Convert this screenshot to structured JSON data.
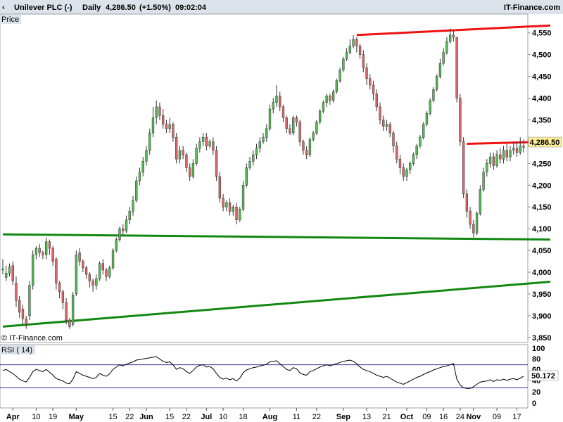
{
  "header": {
    "instrument": "Unilever PLC (-)",
    "period": "Daily",
    "last": "4,286.50",
    "change": "(+1.50%)",
    "time": "09:02:04",
    "brand": "IT-Finance.com"
  },
  "price_panel": {
    "label": "Price",
    "watermark": "© IT-Finance.com",
    "current_price_label": "4,286.50"
  },
  "rsi_panel": {
    "label": "RSI ( 14)",
    "current_value_label": "50.172",
    "ticks": [
      "100",
      "80",
      "60",
      "40",
      "20",
      "0"
    ]
  },
  "colors": {
    "up_candle": "#55bb55",
    "down_candle": "#dd6666",
    "resistance": "#ee1111",
    "support": "#118811",
    "rsi_line": "#000000",
    "rsi_band": "#333399",
    "header_bg": "#dde3ea",
    "price_tag_bg": "#ffee99"
  },
  "chart_data": {
    "type": "candlestick",
    "ylim": [
      3840,
      4590
    ],
    "y_ticks": [
      3850,
      3900,
      3950,
      4000,
      4050,
      4100,
      4150,
      4200,
      4250,
      4300,
      4350,
      4400,
      4450,
      4500,
      4550
    ],
    "y_tick_labels": [
      "3,850",
      "3,900",
      "3,950",
      "4,000",
      "4,050",
      "4,100",
      "4,150",
      "4,200",
      "4,250",
      "4,300",
      "4,350",
      "4,400",
      "4,450",
      "4,500",
      "4,550"
    ],
    "x_tick_labels": [
      "Apr",
      "10",
      "19",
      "May",
      "15",
      "22",
      "Jun",
      "15",
      "22",
      "Jul",
      "10",
      "18",
      "Aug",
      "11",
      "22",
      "Sep",
      "13",
      "21",
      "Oct",
      "09",
      "16",
      "24",
      "Nov",
      "09",
      "17"
    ],
    "x_tick_bold": [
      "Apr",
      "May",
      "Jun",
      "Jul",
      "Aug",
      "Sep",
      "Oct",
      "Nov"
    ],
    "x_tick_index": [
      3,
      10,
      15,
      22,
      33,
      38,
      43,
      50,
      55,
      61,
      66,
      72,
      80,
      88,
      94,
      102,
      109,
      115,
      121,
      127,
      132,
      137,
      141,
      148,
      154
    ],
    "candles": [
      [
        4005,
        4008,
        4030,
        3995
      ],
      [
        3988,
        3998,
        4015,
        3980
      ],
      [
        3998,
        4012,
        4020,
        3990
      ],
      [
        4015,
        3980,
        4025,
        3970
      ],
      [
        3975,
        3935,
        3990,
        3920
      ],
      [
        3935,
        3908,
        3945,
        3895
      ],
      [
        3915,
        3893,
        3925,
        3880
      ],
      [
        3892,
        3880,
        3900,
        3870
      ],
      [
        3900,
        3970,
        3980,
        3890
      ],
      [
        3970,
        4040,
        4050,
        3960
      ],
      [
        4040,
        4055,
        4060,
        4030
      ],
      [
        4055,
        4045,
        4065,
        4035
      ],
      [
        4045,
        4040,
        4050,
        4030
      ],
      [
        4040,
        4070,
        4080,
        4030
      ],
      [
        4070,
        4055,
        4075,
        4040
      ],
      [
        4055,
        4025,
        4060,
        4015
      ],
      [
        4030,
        3975,
        4035,
        3960
      ],
      [
        3975,
        3955,
        3980,
        3940
      ],
      [
        3955,
        3930,
        3960,
        3915
      ],
      [
        3930,
        3890,
        3940,
        3880
      ],
      [
        3890,
        3875,
        3895,
        3870
      ],
      [
        3880,
        3948,
        3955,
        3875
      ],
      [
        3950,
        4040,
        4050,
        3945
      ],
      [
        4045,
        4025,
        4055,
        4015
      ],
      [
        4025,
        4010,
        4030,
        4000
      ],
      [
        4010,
        3995,
        4015,
        3985
      ],
      [
        3995,
        3980,
        4000,
        3965
      ],
      [
        3980,
        3970,
        3985,
        3955
      ],
      [
        3970,
        3985,
        3995,
        3960
      ],
      [
        3985,
        4020,
        4025,
        3980
      ],
      [
        4020,
        4005,
        4030,
        3995
      ],
      [
        4005,
        3990,
        4010,
        3980
      ],
      [
        3990,
        4010,
        4015,
        3985
      ],
      [
        4010,
        4050,
        4055,
        4005
      ],
      [
        4050,
        4075,
        4080,
        4045
      ],
      [
        4075,
        4100,
        4105,
        4070
      ],
      [
        4100,
        4095,
        4110,
        4085
      ],
      [
        4095,
        4120,
        4130,
        4090
      ],
      [
        4120,
        4140,
        4150,
        4110
      ],
      [
        4140,
        4165,
        4175,
        4130
      ],
      [
        4165,
        4210,
        4220,
        4160
      ],
      [
        4210,
        4230,
        4240,
        4200
      ],
      [
        4230,
        4255,
        4265,
        4220
      ],
      [
        4255,
        4280,
        4290,
        4245
      ],
      [
        4280,
        4320,
        4330,
        4270
      ],
      [
        4320,
        4355,
        4380,
        4310
      ],
      [
        4355,
        4380,
        4395,
        4340
      ],
      [
        4380,
        4360,
        4390,
        4350
      ],
      [
        4360,
        4340,
        4375,
        4330
      ],
      [
        4340,
        4330,
        4350,
        4320
      ],
      [
        4330,
        4340,
        4355,
        4320
      ],
      [
        4340,
        4310,
        4345,
        4300
      ],
      [
        4310,
        4260,
        4320,
        4250
      ],
      [
        4260,
        4280,
        4290,
        4250
      ],
      [
        4280,
        4270,
        4290,
        4260
      ],
      [
        4270,
        4240,
        4275,
        4230
      ],
      [
        4240,
        4220,
        4250,
        4210
      ],
      [
        4220,
        4250,
        4260,
        4215
      ],
      [
        4250,
        4285,
        4295,
        4245
      ],
      [
        4285,
        4300,
        4310,
        4275
      ],
      [
        4300,
        4310,
        4320,
        4290
      ],
      [
        4310,
        4290,
        4320,
        4280
      ],
      [
        4290,
        4300,
        4305,
        4285
      ],
      [
        4300,
        4280,
        4310,
        4270
      ],
      [
        4280,
        4220,
        4290,
        4210
      ],
      [
        4220,
        4170,
        4230,
        4160
      ],
      [
        4170,
        4150,
        4180,
        4140
      ],
      [
        4150,
        4160,
        4165,
        4140
      ],
      [
        4160,
        4140,
        4170,
        4130
      ],
      [
        4140,
        4150,
        4155,
        4130
      ],
      [
        4150,
        4120,
        4160,
        4110
      ],
      [
        4120,
        4145,
        4150,
        4115
      ],
      [
        4145,
        4200,
        4210,
        4140
      ],
      [
        4200,
        4240,
        4250,
        4195
      ],
      [
        4240,
        4255,
        4265,
        4235
      ],
      [
        4255,
        4270,
        4280,
        4245
      ],
      [
        4270,
        4285,
        4295,
        4260
      ],
      [
        4285,
        4300,
        4310,
        4275
      ],
      [
        4300,
        4310,
        4320,
        4295
      ],
      [
        4310,
        4330,
        4340,
        4300
      ],
      [
        4330,
        4375,
        4385,
        4325
      ],
      [
        4375,
        4390,
        4400,
        4365
      ],
      [
        4390,
        4405,
        4430,
        4380
      ],
      [
        4405,
        4380,
        4415,
        4370
      ],
      [
        4380,
        4355,
        4385,
        4345
      ],
      [
        4355,
        4330,
        4360,
        4320
      ],
      [
        4330,
        4320,
        4340,
        4315
      ],
      [
        4320,
        4355,
        4360,
        4315
      ],
      [
        4355,
        4345,
        4360,
        4335
      ],
      [
        4345,
        4300,
        4350,
        4290
      ],
      [
        4300,
        4280,
        4305,
        4270
      ],
      [
        4280,
        4270,
        4290,
        4260
      ],
      [
        4270,
        4305,
        4310,
        4265
      ],
      [
        4305,
        4320,
        4325,
        4300
      ],
      [
        4320,
        4345,
        4350,
        4315
      ],
      [
        4345,
        4370,
        4375,
        4340
      ],
      [
        4370,
        4390,
        4395,
        4365
      ],
      [
        4390,
        4405,
        4410,
        4380
      ],
      [
        4405,
        4395,
        4410,
        4385
      ],
      [
        4395,
        4415,
        4420,
        4390
      ],
      [
        4415,
        4440,
        4445,
        4410
      ],
      [
        4440,
        4465,
        4470,
        4435
      ],
      [
        4465,
        4490,
        4495,
        4460
      ],
      [
        4490,
        4505,
        4515,
        4485
      ],
      [
        4505,
        4520,
        4535,
        4500
      ],
      [
        4520,
        4535,
        4545,
        4515
      ],
      [
        4535,
        4520,
        4540,
        4505
      ],
      [
        4520,
        4500,
        4525,
        4490
      ],
      [
        4500,
        4470,
        4510,
        4460
      ],
      [
        4470,
        4445,
        4480,
        4430
      ],
      [
        4445,
        4430,
        4455,
        4420
      ],
      [
        4430,
        4410,
        4440,
        4395
      ],
      [
        4410,
        4380,
        4420,
        4370
      ],
      [
        4380,
        4350,
        4390,
        4340
      ],
      [
        4350,
        4335,
        4360,
        4325
      ],
      [
        4335,
        4340,
        4350,
        4325
      ],
      [
        4340,
        4320,
        4345,
        4310
      ],
      [
        4320,
        4290,
        4325,
        4275
      ],
      [
        4290,
        4260,
        4300,
        4250
      ],
      [
        4260,
        4240,
        4270,
        4225
      ],
      [
        4240,
        4220,
        4250,
        4210
      ],
      [
        4220,
        4235,
        4240,
        4210
      ],
      [
        4235,
        4250,
        4255,
        4225
      ],
      [
        4250,
        4270,
        4275,
        4245
      ],
      [
        4270,
        4290,
        4295,
        4260
      ],
      [
        4290,
        4310,
        4315,
        4285
      ],
      [
        4310,
        4340,
        4345,
        4305
      ],
      [
        4340,
        4365,
        4370,
        4335
      ],
      [
        4365,
        4395,
        4400,
        4360
      ],
      [
        4395,
        4420,
        4425,
        4390
      ],
      [
        4420,
        4450,
        4455,
        4415
      ],
      [
        4450,
        4480,
        4490,
        4445
      ],
      [
        4480,
        4505,
        4515,
        4475
      ],
      [
        4505,
        4530,
        4540,
        4500
      ],
      [
        4530,
        4545,
        4560,
        4525
      ],
      [
        4545,
        4540,
        4555,
        4530
      ],
      [
        4540,
        4400,
        4450,
        4390
      ],
      [
        4400,
        4300,
        4410,
        4290
      ],
      [
        4300,
        4180,
        4310,
        4170
      ],
      [
        4180,
        4140,
        4190,
        4125
      ],
      [
        4140,
        4110,
        4150,
        4100
      ],
      [
        4110,
        4090,
        4120,
        4080
      ],
      [
        4090,
        4135,
        4140,
        4085
      ],
      [
        4135,
        4190,
        4200,
        4130
      ],
      [
        4190,
        4230,
        4240,
        4185
      ],
      [
        4230,
        4250,
        4260,
        4220
      ],
      [
        4250,
        4265,
        4275,
        4240
      ],
      [
        4265,
        4245,
        4275,
        4235
      ],
      [
        4245,
        4270,
        4280,
        4240
      ],
      [
        4270,
        4260,
        4285,
        4250
      ],
      [
        4260,
        4280,
        4290,
        4250
      ],
      [
        4280,
        4265,
        4295,
        4255
      ],
      [
        4265,
        4280,
        4290,
        4255
      ],
      [
        4280,
        4285,
        4300,
        4270
      ],
      [
        4285,
        4275,
        4300,
        4265
      ],
      [
        4275,
        4290,
        4310,
        4270
      ],
      [
        4290,
        4287,
        4305,
        4275
      ]
    ],
    "trendlines": [
      {
        "color": "red",
        "from": [
          106,
          4545
        ],
        "to": [
          164,
          4567
        ]
      },
      {
        "color": "red",
        "from": [
          139,
          4295
        ],
        "to": [
          164,
          4300
        ]
      },
      {
        "color": "green",
        "from": [
          0,
          4087
        ],
        "to": [
          164,
          4075
        ]
      },
      {
        "color": "green",
        "from": [
          0,
          3875
        ],
        "to": [
          164,
          3978
        ]
      }
    ],
    "rsi": {
      "ylim": [
        0,
        100
      ],
      "levels": [
        70,
        30
      ],
      "values": [
        60,
        62,
        58,
        55,
        50,
        45,
        42,
        40,
        48,
        58,
        62,
        60,
        58,
        62,
        57,
        52,
        46,
        44,
        42,
        38,
        37,
        45,
        58,
        55,
        52,
        50,
        48,
        46,
        48,
        55,
        52,
        50,
        54,
        62,
        66,
        70,
        68,
        71,
        73,
        75,
        78,
        79,
        80,
        81,
        82,
        83,
        84,
        80,
        76,
        74,
        75,
        70,
        62,
        65,
        63,
        58,
        55,
        60,
        66,
        69,
        70,
        66,
        67,
        63,
        55,
        48,
        45,
        47,
        44,
        46,
        42,
        47,
        56,
        61,
        63,
        65,
        66,
        68,
        69,
        71,
        75,
        76,
        77,
        72,
        67,
        62,
        60,
        65,
        63,
        56,
        53,
        52,
        58,
        60,
        63,
        66,
        68,
        70,
        68,
        70,
        72,
        74,
        76,
        77,
        78,
        76,
        72,
        66,
        62,
        60,
        58,
        55,
        52,
        50,
        48,
        50,
        47,
        43,
        40,
        38,
        36,
        39,
        42,
        45,
        48,
        50,
        53,
        56,
        58,
        61,
        63,
        65,
        67,
        68,
        70,
        72,
        45,
        35,
        30,
        29,
        29,
        32,
        36,
        40,
        41,
        42,
        44,
        41,
        44,
        43,
        45,
        43,
        45,
        46,
        44,
        47,
        50
      ]
    }
  }
}
